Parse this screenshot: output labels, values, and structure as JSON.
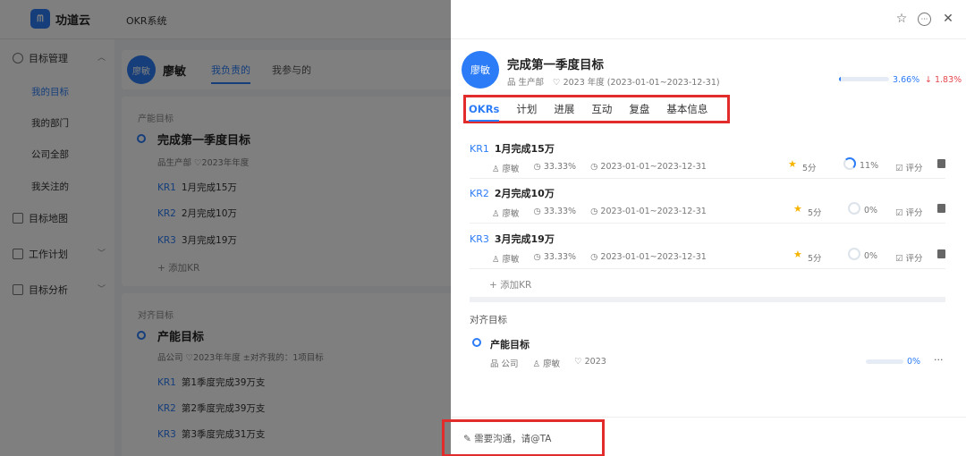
{
  "app": {
    "name": "功道云",
    "logo_text": "ᗰ",
    "system_title": "OKR系统"
  },
  "sidebar": {
    "groups": [
      {
        "label": "目标管理",
        "icon": "target-icon"
      },
      {
        "label": "目标地图",
        "icon": "map-icon"
      },
      {
        "label": "工作计划",
        "icon": "plan-icon"
      },
      {
        "label": "目标分析",
        "icon": "chart-icon"
      }
    ],
    "sub_items": [
      "我的目标",
      "我的部门",
      "公司全部",
      "我关注的"
    ]
  },
  "background": {
    "owner_avatar": "廖敏",
    "owner_name": "廖敏",
    "tab_mine": "我负责的",
    "tab_joined": "我参与的",
    "card1": {
      "label": "产能目标",
      "title": "完成第一季度目标",
      "meta": "品生产部  ♡2023年年度",
      "krs": [
        {
          "tag": "KR1",
          "text": "1月完成15万"
        },
        {
          "tag": "KR2",
          "text": "2月完成10万"
        },
        {
          "tag": "KR3",
          "text": "3月完成19万"
        }
      ],
      "add_kr": "+ 添加KR"
    },
    "card2": {
      "label": "对齐目标",
      "title": "产能目标",
      "meta": "品公司  ♡2023年年度  ±对齐我的：1项目标",
      "krs": [
        {
          "tag": "KR1",
          "text": "第1季度完成39万支"
        },
        {
          "tag": "KR2",
          "text": "第2季度完成39万支"
        },
        {
          "tag": "KR3",
          "text": "第3季度完成31万支"
        }
      ]
    }
  },
  "drawer": {
    "header_icons": [
      "star-icon",
      "more-icon",
      "close-icon"
    ],
    "star": "☆",
    "more": "···",
    "close": "✕",
    "avatar": "廖敏",
    "title": "完成第一季度目标",
    "department": "品 生产部",
    "period": "♡ 2023 年度 (2023-01-01~2023-12-31)",
    "progress_percent": 3.66,
    "progress_text": "3.66%",
    "delta_text": "↓ 1.83%",
    "tabs": [
      "OKRs",
      "计划",
      "进展",
      "互动",
      "复盘",
      "基本信息"
    ],
    "kr_list": [
      {
        "tag": "KR1",
        "title": "1月完成15万",
        "owner": "♙ 廖敏",
        "weight": "◷ 33.33%",
        "period": "◷ 2023-01-01~2023-12-31",
        "star": "★",
        "score": "5分",
        "progress": "11%",
        "rate": "☑ 评分"
      },
      {
        "tag": "KR2",
        "title": "2月完成10万",
        "owner": "♙ 廖敏",
        "weight": "◷ 33.33%",
        "period": "◷ 2023-01-01~2023-12-31",
        "star": "★",
        "score": "5分",
        "progress": "0%",
        "rate": "☑ 评分"
      },
      {
        "tag": "KR3",
        "title": "3月完成19万",
        "owner": "♙ 廖敏",
        "weight": "◷ 33.33%",
        "period": "◷ 2023-01-01~2023-12-31",
        "star": "★",
        "score": "5分",
        "progress": "0%",
        "rate": "☑ 评分"
      }
    ],
    "add_kr": "+ 添加KR",
    "align_section_label": "对齐目标",
    "aligned": {
      "title": "产能目标",
      "org": "品 公司",
      "owner": "♙ 廖敏",
      "year": "♡ 2023",
      "progress": "0%",
      "more": "···"
    },
    "footer_placeholder": "✎ 需要沟通，请@TA"
  },
  "colors": {
    "accent": "#2b7cf6",
    "highlight_box": "#e22b2b",
    "star": "#f5b400",
    "down": "#e5484d"
  }
}
